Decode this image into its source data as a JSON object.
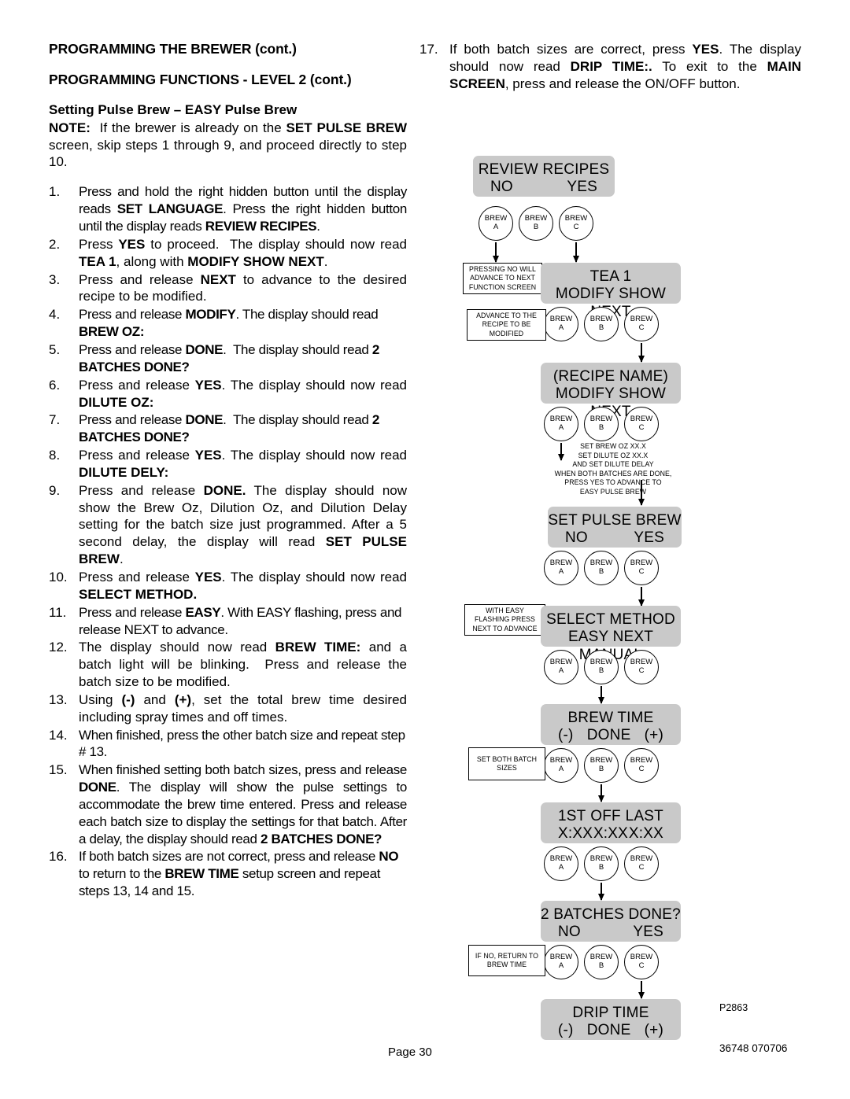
{
  "document": {
    "page_label": "Page 30",
    "doc_code": "P2863",
    "doc_number": "36748 070706"
  },
  "left_column": {
    "heading1": "PROGRAMMING THE BREWER (cont.)",
    "heading2": "PROGRAMMING FUNCTIONS - LEVEL  2 (cont.)",
    "heading3": "Setting Pulse Brew – EASY Pulse Brew",
    "note_label": "NOTE:",
    "note_text": "If the brewer is already on the SET PULSE BREW screen, skip steps 1 through 9, and proceed directly to step 10.",
    "steps": [
      {
        "num": "1.",
        "text": "Press and hold the right hidden button until the display reads SET LANGUAGE. Press the right hidden button until the display reads REVIEW RECIPES."
      },
      {
        "num": "2.",
        "text": "Press YES to proceed.  The display should now read TEA 1, along with MODIFY SHOW NEXT."
      },
      {
        "num": "3.",
        "text": "Press and release NEXT to advance to the desired recipe to be modified."
      },
      {
        "num": "4.",
        "text": "Press and release MODIFY. The display should read BREW OZ:"
      },
      {
        "num": "5.",
        "text": "Press and release DONE.  The display should read 2 BATCHES DONE?"
      },
      {
        "num": "6.",
        "text": "Press and release YES. The display should now read DILUTE OZ:"
      },
      {
        "num": "7.",
        "text": "Press and release DONE.  The display should read 2 BATCHES DONE?"
      },
      {
        "num": "8.",
        "text": "Press and release YES. The display should now read DILUTE DELY:"
      },
      {
        "num": "9.",
        "text": "Press and release DONE. The display should now show the Brew Oz, Dilution Oz, and Dilution Delay setting for the batch size just programmed. After a 5 second delay, the display will read SET PULSE BREW."
      },
      {
        "num": "10.",
        "text": "Press and release YES. The display should now read SELECT METHOD."
      },
      {
        "num": "11.",
        "text": "Press and release EASY. With EASY flashing, press and release NEXT to advance."
      },
      {
        "num": "12.",
        "text": "The display should now read BREW TIME: and a batch light will be blinking.  Press and release the batch size to be modified."
      },
      {
        "num": "13.",
        "text": "Using (-) and (+), set the total brew time desired including spray times and off times."
      },
      {
        "num": "14.",
        "text": "When finished, press the other batch size and repeat step # 13."
      },
      {
        "num": "15.",
        "text": "When finished setting both batch sizes, press and release DONE. The display will show the pulse settings to accommodate the brew time entered. Press and release each batch size to display the settings for that batch. After a delay, the display should read 2 BATCHES DONE?"
      },
      {
        "num": "16.",
        "text": "If both batch sizes are not correct, press and release NO to return to the BREW TIME setup screen and repeat steps 13, 14 and 15."
      }
    ]
  },
  "right_column": {
    "step17": {
      "num": "17.",
      "text": "If both batch sizes are correct, press YES. The display should now read DRIP TIME:. To exit to the MAIN SCREEN, press and release the ON/OFF button."
    }
  },
  "flowchart": {
    "screens": [
      {
        "id": "review-recipes",
        "line1": "REVIEW RECIPES",
        "left": "NO",
        "right": "YES"
      },
      {
        "id": "tea-1",
        "line1": "TEA 1",
        "line2": "MODIFY SHOW NEXT"
      },
      {
        "id": "recipe-name",
        "line1": "(RECIPE NAME)",
        "line2": "MODIFY SHOW NEXT"
      },
      {
        "id": "set-pulse-brew",
        "line1": "SET PULSE BREW",
        "left": "NO",
        "right": "YES"
      },
      {
        "id": "select-method",
        "line1": "SELECT METHOD",
        "line2": "EASY NEXT MANUAL"
      },
      {
        "id": "brew-time",
        "line1": "BREW TIME",
        "left": "(-)",
        "center": "DONE",
        "right": "(+)"
      },
      {
        "id": "pulse-times",
        "l1a": "1ST",
        "l1b": "OFF",
        "l1c": "LAST",
        "l2a": "X:XX",
        "l2b": "X:XX",
        "l2c": "X:XX"
      },
      {
        "id": "two-batches-done",
        "line1": "2 BATCHES DONE?",
        "left": "NO",
        "right": "YES"
      },
      {
        "id": "drip-time",
        "line1": "DRIP TIME",
        "left": "(-)",
        "center": "DONE",
        "right": "(+)"
      }
    ],
    "button_label_top": "BREW",
    "buttons": {
      "a": "A",
      "b": "B",
      "c": "C"
    },
    "annotations": [
      {
        "id": "pressing-no",
        "text": "PRESSING NO WILL ADVANCE TO NEXT FUNCTION SCREEN"
      },
      {
        "id": "advance-recipe",
        "text": "ADVANCE TO THE RECIPE TO BE MODIFIED"
      },
      {
        "id": "with-easy-flashing",
        "text": "WITH EASY FLASHING PRESS NEXT TO ADVANCE"
      },
      {
        "id": "set-both-batch-sizes",
        "text": "SET BOTH BATCH SIZES"
      },
      {
        "id": "if-no-return",
        "text": "IF NO, RETURN TO BREW TIME"
      }
    ],
    "free_note": {
      "id": "set-brew-oz-note",
      "lines": [
        "SET BREW OZ  XX.X",
        "SET DILUTE OZ  XX.X",
        "AND SET DILUTE DELAY",
        "WHEN BOTH BATCHES ARE DONE,",
        "PRESS YES TO ADVANCE TO",
        "EASY PULSE BREW"
      ]
    }
  },
  "colors": {
    "screen_gray": "#c9c9c9",
    "ink": "#000000",
    "paper": "#ffffff"
  }
}
